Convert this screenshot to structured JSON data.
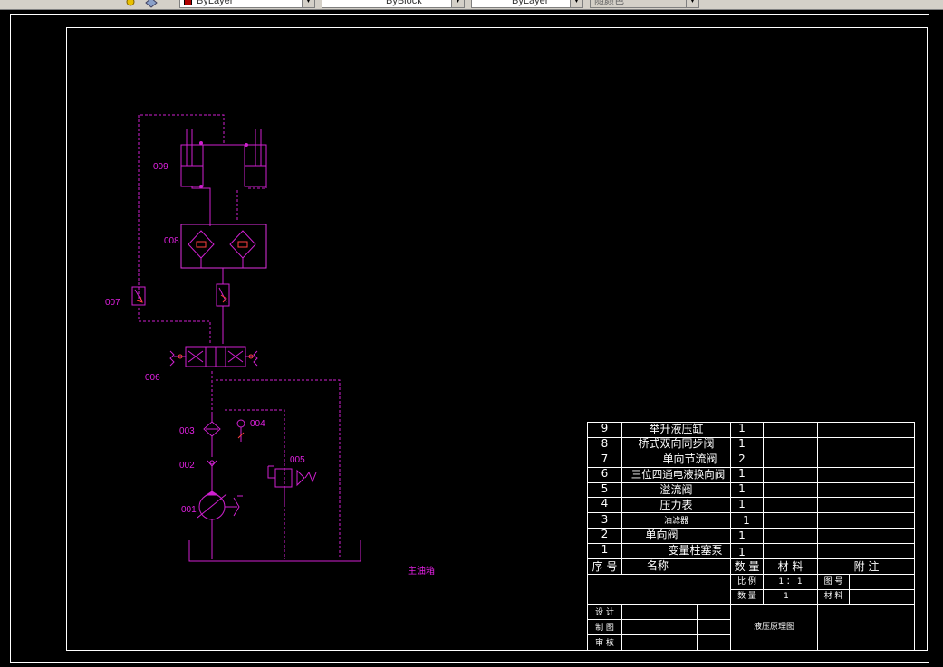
{
  "toolbar": {
    "color_combo": "ByLayer",
    "linetype_combo": "ByBlock",
    "lineweight_combo": "ByLayer",
    "plotstyle_combo": "随颜色"
  },
  "labels": {
    "l009": "009",
    "l008": "008",
    "l007": "007",
    "l006": "006",
    "l003": "003",
    "l004": "004",
    "l002": "002",
    "l005": "005",
    "l001": "001",
    "tank": "主油箱"
  },
  "parts": [
    {
      "no": "9",
      "name": "举升液压缸",
      "qty": "1"
    },
    {
      "no": "8",
      "name": "桥式双向同步阀",
      "qty": "1"
    },
    {
      "no": "7",
      "name": "单向节流阀",
      "qty": "2"
    },
    {
      "no": "6",
      "name": "三位四通电液换向阀",
      "qty": "1"
    },
    {
      "no": "5",
      "name": "溢流阀",
      "qty": "1"
    },
    {
      "no": "4",
      "name": "压力表",
      "qty": "1"
    },
    {
      "no": "3",
      "name": "油滤器",
      "qty": "1"
    },
    {
      "no": "2",
      "name": "单向阀",
      "qty": "1"
    },
    {
      "no": "1",
      "name": "变量柱塞泵",
      "qty": "1"
    }
  ],
  "header": {
    "no": "序 号",
    "name": "名称",
    "qty": "数 量",
    "material": "材   料",
    "note": "附   注"
  },
  "title_block": {
    "scale_label": "比   例",
    "scale_value": "1 ： 1",
    "drawing_no_label": "图   号",
    "count_label": "数   量",
    "count_value": "1",
    "material_label": "材   料",
    "design": "设   计",
    "draw": "制   图",
    "review": "审   核",
    "title": "液压原理图"
  }
}
